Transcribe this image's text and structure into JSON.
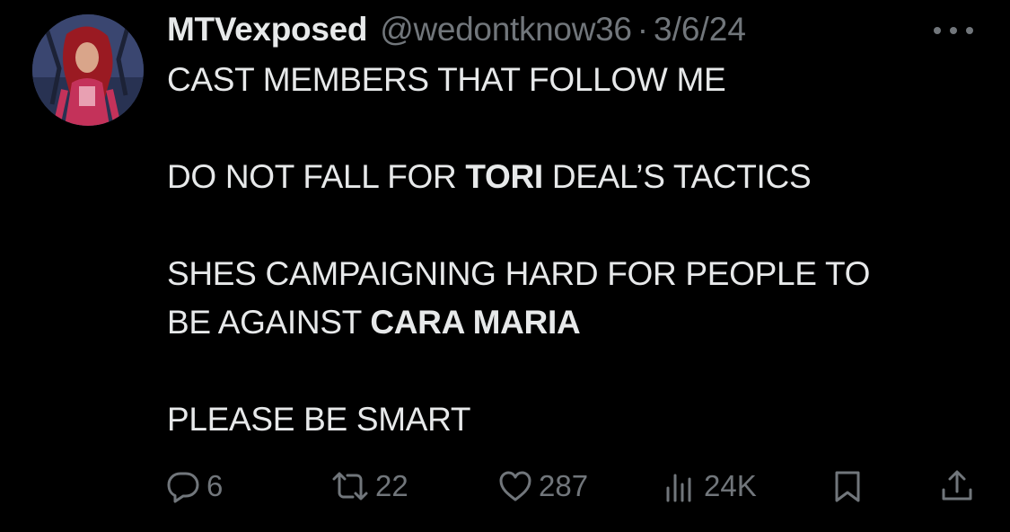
{
  "tweet": {
    "display_name": "MTVexposed",
    "handle": "@wedontknow36",
    "separator": "·",
    "date": "3/6/24",
    "lines": {
      "l1": "CAST MEMBERS THAT FOLLOW ME",
      "l2_pre": "DO NOT FALL FOR ",
      "l2_bold": "TORI",
      "l2_post": " DEAL’S TACTICS",
      "l3": "SHES CAMPAIGNING HARD FOR PEOPLE TO",
      "l4_pre": "BE AGAINST ",
      "l4_bold": "CARA MARIA",
      "l5": "PLEASE BE SMART"
    },
    "stats": {
      "replies": "6",
      "reposts": "22",
      "likes": "287",
      "views": "24K"
    }
  },
  "icons": {
    "more": "more-dots-icon",
    "reply": "reply-icon",
    "repost": "repost-icon",
    "like": "heart-icon",
    "views": "views-icon",
    "bookmark": "bookmark-icon",
    "share": "share-icon"
  },
  "colors": {
    "background": "#000000",
    "primary_text": "#e7e9ea",
    "secondary_text": "#71767b"
  }
}
